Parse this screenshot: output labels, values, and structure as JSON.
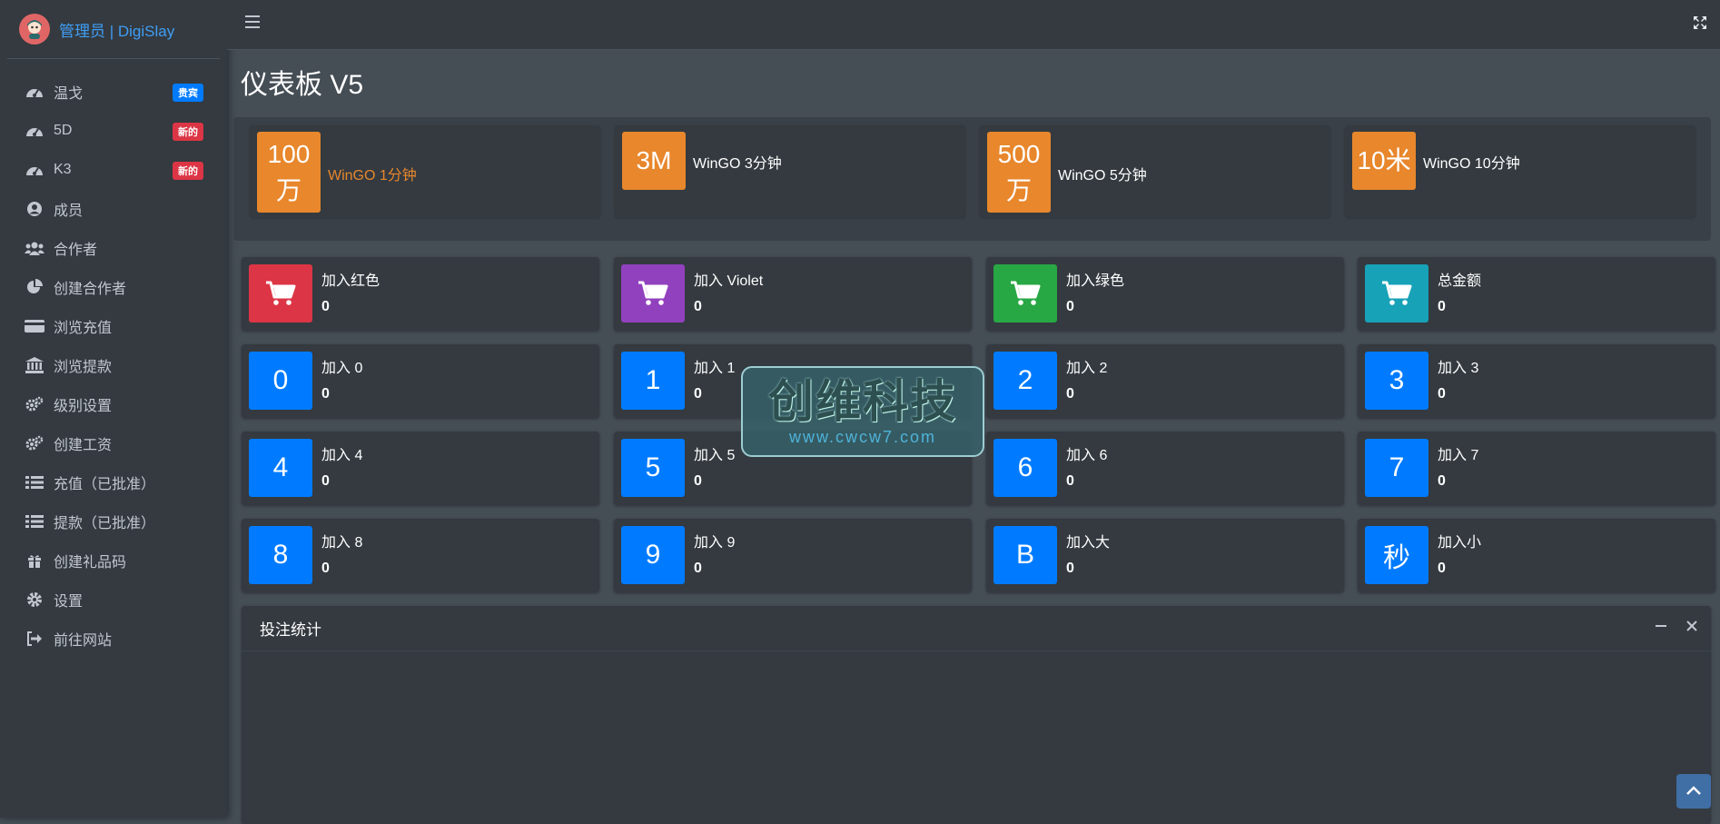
{
  "brand": {
    "text": "管理员 | DigiSlay"
  },
  "sidebar": {
    "items": [
      {
        "label": "温戈",
        "icon": "tachometer-icon",
        "badge": "贵宾",
        "badge_color": "#007bff"
      },
      {
        "label": "5D",
        "icon": "tachometer-icon",
        "badge": "新的",
        "badge_color": "#dc3545"
      },
      {
        "label": "K3",
        "icon": "tachometer-icon",
        "badge": "新的",
        "badge_color": "#dc3545"
      },
      {
        "label": "成员",
        "icon": "user-circle-icon"
      },
      {
        "label": "合作者",
        "icon": "users-icon"
      },
      {
        "label": "创建合作者",
        "icon": "pie-chart-icon"
      },
      {
        "label": "浏览充值",
        "icon": "credit-card-icon"
      },
      {
        "label": "浏览提款",
        "icon": "bank-icon"
      },
      {
        "label": "级别设置",
        "icon": "cogs-icon"
      },
      {
        "label": "创建工资",
        "icon": "cogs-icon"
      },
      {
        "label": "充值（已批准）",
        "icon": "list-icon"
      },
      {
        "label": "提款（已批准）",
        "icon": "list-icon"
      },
      {
        "label": "创建礼品码",
        "icon": "gift-icon"
      },
      {
        "label": "设置",
        "icon": "gear-icon"
      },
      {
        "label": "前往网站",
        "icon": "sign-out-icon"
      }
    ]
  },
  "page": {
    "title": "仪表板 V5"
  },
  "timers": [
    {
      "box_line1": "100",
      "box_line2": "万",
      "label": "WinGO 1分钟",
      "active": true
    },
    {
      "box_line1": "3M",
      "box_line2": "",
      "label": "WinGO 3分钟",
      "active": false
    },
    {
      "box_line1": "500",
      "box_line2": "万",
      "label": "WinGO 5分钟",
      "active": false
    },
    {
      "box_line1": "10米",
      "box_line2": "",
      "label": "WinGO 10分钟",
      "active": false
    }
  ],
  "stats": [
    {
      "icon": "cart-icon",
      "color": "#dc3545",
      "label": "加入红色",
      "value": "0"
    },
    {
      "icon": "cart-icon",
      "color": "#9241be",
      "label": "加入 Violet",
      "value": "0"
    },
    {
      "icon": "cart-icon",
      "color": "#28a745",
      "label": "加入绿色",
      "value": "0"
    },
    {
      "icon": "cart-icon",
      "color": "#17a2b8",
      "label": "总金额",
      "value": "0"
    },
    {
      "box": "0",
      "label": "加入 0",
      "value": "0"
    },
    {
      "box": "1",
      "label": "加入 1",
      "value": "0"
    },
    {
      "box": "2",
      "label": "加入 2",
      "value": "0"
    },
    {
      "box": "3",
      "label": "加入 3",
      "value": "0"
    },
    {
      "box": "4",
      "label": "加入 4",
      "value": "0"
    },
    {
      "box": "5",
      "label": "加入 5",
      "value": "0"
    },
    {
      "box": "6",
      "label": "加入 6",
      "value": "0"
    },
    {
      "box": "7",
      "label": "加入 7",
      "value": "0"
    },
    {
      "box": "8",
      "label": "加入 8",
      "value": "0"
    },
    {
      "box": "9",
      "label": "加入 9",
      "value": "0"
    },
    {
      "box": "B",
      "label": "加入大",
      "value": "0"
    },
    {
      "box": "秒",
      "label": "加入小",
      "value": "0"
    }
  ],
  "chart_panel": {
    "title": "投注统计"
  },
  "watermark": {
    "title": "创维科技",
    "url": "www.cwcw7.com"
  },
  "colors": {
    "accent_orange": "#e8872c",
    "number_blue": "#007bff",
    "brand_blue": "#3f9ef5"
  }
}
